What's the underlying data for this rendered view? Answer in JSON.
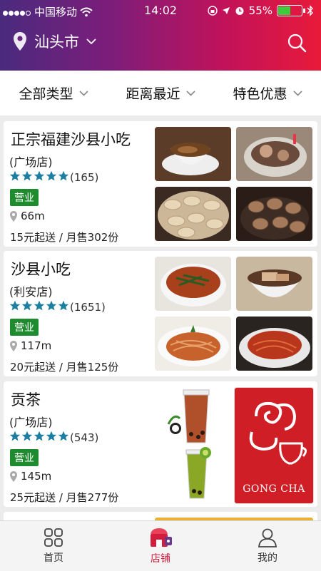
{
  "status_bar": {
    "carrier": "中国移动",
    "time": "14:02",
    "battery_percent": "55%",
    "battery_level": 0.55
  },
  "header": {
    "city": "汕头市",
    "icons": [
      "location-pin-icon",
      "chevron-down-icon",
      "search-icon"
    ]
  },
  "filters": [
    {
      "label": "全部类型"
    },
    {
      "label": "距离最近"
    },
    {
      "label": "特色优惠"
    }
  ],
  "shops": [
    {
      "name": "正宗福建沙县小吃",
      "branch": "(广场店)",
      "stars": 5,
      "review_count": "(165)",
      "status": "营业",
      "distance": "66m",
      "sales": "15元起送 / 月售302份"
    },
    {
      "name": "沙县小吃",
      "branch": "(利安店)",
      "stars": 5,
      "review_count": "(1651)",
      "status": "营业",
      "distance": "117m",
      "sales": "20元起送 / 月售125份"
    },
    {
      "name": "贡茶",
      "branch": "(广场店)",
      "stars": 5,
      "review_count": "(543)",
      "status": "营业",
      "distance": "145m",
      "sales": "25元起送 / 月售277份",
      "logo_text": "GONG CHA"
    }
  ],
  "tabbar": [
    {
      "label": "首页",
      "icon": "home-grid-icon"
    },
    {
      "label": "店铺",
      "icon": "shop-icon",
      "active": true
    },
    {
      "label": "我的",
      "icon": "user-icon"
    }
  ],
  "colors": {
    "accent_red": "#d21d3c",
    "open_green": "#1e8b2e",
    "star_teal": "#1c7ea0",
    "header_gradient": [
      "#4a2a7e",
      "#e81a3a"
    ]
  }
}
